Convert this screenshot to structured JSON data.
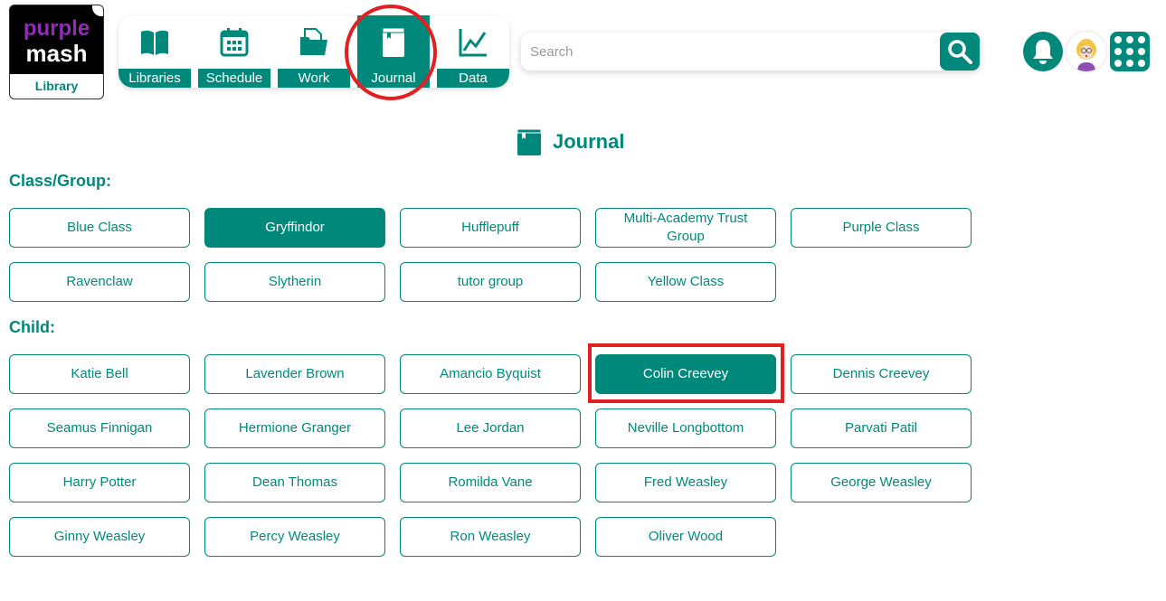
{
  "logo": {
    "line1": "purple",
    "line2": "mash",
    "line3": "Library"
  },
  "nav": [
    {
      "label": "Libraries",
      "icon": "book-open-icon"
    },
    {
      "label": "Schedule",
      "icon": "calendar-icon"
    },
    {
      "label": "Work",
      "icon": "folder-icon"
    },
    {
      "label": "Journal",
      "icon": "journal-icon",
      "active": true
    },
    {
      "label": "Data",
      "icon": "chart-line-icon"
    }
  ],
  "search": {
    "placeholder": "Search",
    "value": ""
  },
  "page_title": "Journal",
  "class_label": "Class/Group:",
  "classes": [
    "Blue Class",
    "Gryffindor",
    "Hufflepuff",
    "Multi-Academy Trust Group",
    "Purple Class",
    "Ravenclaw",
    "Slytherin",
    "tutor group",
    "Yellow Class"
  ],
  "selected_class": "Gryffindor",
  "child_label": "Child:",
  "children": [
    "Katie Bell",
    "Lavender Brown",
    "Amancio Byquist",
    "Colin Creevey",
    "Dennis Creevey",
    "Seamus Finnigan",
    "Hermione Granger",
    "Lee Jordan",
    "Neville Longbottom",
    "Parvati Patil",
    "Harry Potter",
    "Dean Thomas",
    "Romilda Vane",
    "Fred Weasley",
    "George Weasley",
    "Ginny Weasley",
    "Percy Weasley",
    "Ron Weasley",
    "Oliver Wood"
  ],
  "selected_child": "Colin Creevey",
  "colors": {
    "accent": "#00897b",
    "highlight": "#e32020",
    "brand_purple": "#8e2fb2"
  }
}
